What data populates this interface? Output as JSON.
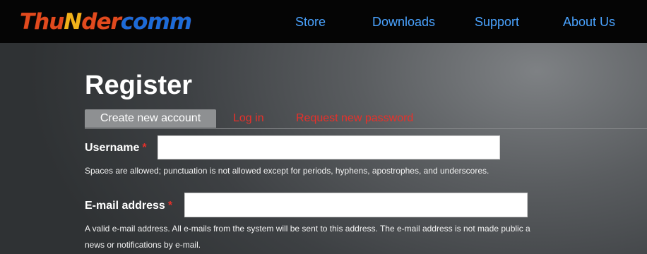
{
  "header": {
    "logo": {
      "part1": "Thu",
      "part2": "N",
      "part3": "der",
      "part4": "comm"
    },
    "nav": [
      "Store",
      "Downloads",
      "Support",
      "About Us"
    ]
  },
  "page": {
    "title": "Register",
    "tabs": {
      "create": "Create new account",
      "login": "Log in",
      "request_password": "Request new password"
    }
  },
  "form": {
    "username": {
      "label": "Username",
      "required_mark": "*",
      "value": "",
      "description": "Spaces are allowed; punctuation is not allowed except for periods, hyphens, apostrophes, and underscores."
    },
    "email": {
      "label": "E-mail address",
      "required_mark": "*",
      "value": "",
      "description_line1": "A valid e-mail address. All e-mails from the system will be sent to this address. The e-mail address is not made public a",
      "description_line2": "news or notifications by e-mail."
    }
  },
  "colors": {
    "topbar": "#050505",
    "nav_link": "#4aa3ff",
    "required": "#e8302a",
    "tab_link": "#e8302a",
    "tab_active_bg": "#8e9092"
  }
}
